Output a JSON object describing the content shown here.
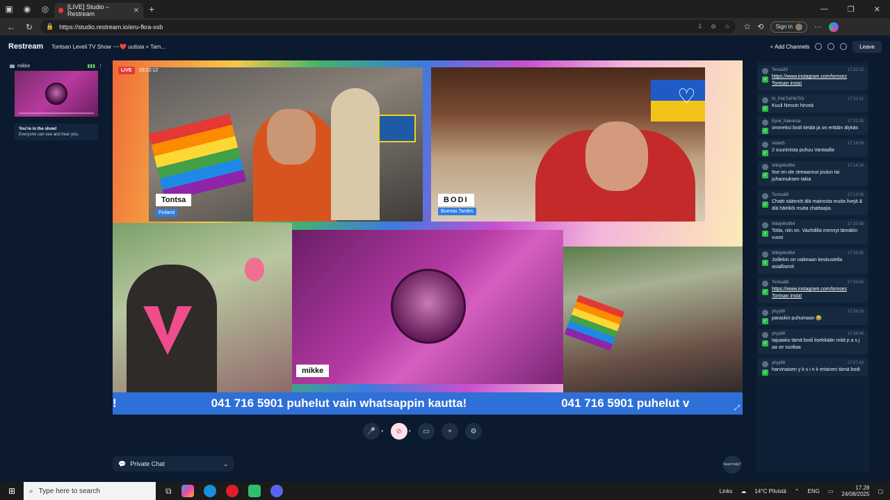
{
  "browser": {
    "tab_title": "[LIVE] Studio – Restream",
    "url": "https://studio.restream.io/eru-fkra-xsb",
    "sign_in_label": "Sign in"
  },
  "header": {
    "brand": "Restream",
    "show_title": "Tontsan Leveli TV Show 〰️❤️ uutisia + Tam...",
    "add_channels": "+ Add Channels",
    "leave": "Leave"
  },
  "left_panel": {
    "preview_name": "mikke",
    "in_show_title": "You're in the show!",
    "in_show_sub": "Everyone can see and hear you."
  },
  "stage": {
    "live_label": "LIVE",
    "live_time": "03:22:12",
    "guest1_name": "Tontsa",
    "guest1_sub": "Finland",
    "guest2_name": "BODI",
    "guest2_sub": "Buenas Tardes",
    "guest3_name": "mikke",
    "ticker_text_a": "!",
    "ticker_text_b": "041 716 5901 puhelut vain whatsappin kautta!",
    "ticker_text_c": "041 716 5901 puhelut v"
  },
  "bottom": {
    "private_chat": "Private Chat",
    "need_help": "Need help?"
  },
  "chat": [
    {
      "user": "Tonsa33",
      "time": "17:22:13",
      "text": "https://www.instagram.com/tomsez Tontsan insta!",
      "link": true
    },
    {
      "user": "M_FAKTAFIKTIO",
      "time": "17:22:11",
      "text": "Kuuli Nessin hirveä",
      "link": false
    },
    {
      "user": "Epok_Nakoksai",
      "time": "17:21:29",
      "text": "ommeksi bodi tietää ja on erittäin älykäs",
      "link": false
    },
    {
      "user": "Aldeb5",
      "time": "17:14:09",
      "text": "2 suurimista puhuu Vantaalla",
      "link": false
    },
    {
      "user": "WildyWolf84",
      "time": "17:14:19",
      "text": "Itse en ole streaannut joulun tai juhannuksen takia",
      "link": false
    },
    {
      "user": "Tontsa88",
      "time": "17:13:08",
      "text": "Chatti säännöt älä mainosta muita livejä & älä häiriköi muita chattaajia.",
      "link": false
    },
    {
      "user": "WildyWolf84",
      "time": "17:10:59",
      "text": "Totta, niin on. Vauhdilla mennyt tämäkin vuosi",
      "link": false
    },
    {
      "user": "WildyWolf84",
      "time": "17:09:35",
      "text": "Joillekin on vaikeaan keskustella asiallisesti",
      "link": false
    },
    {
      "user": "Tontsa88",
      "time": "17:09:44",
      "text": "https://www.instagram.com/tomsez Tontsan insta!",
      "link": true
    },
    {
      "user": "yhyy69",
      "time": "17:08:19",
      "text": "paraskin puhumaan 😂",
      "link": false
    },
    {
      "user": "yhyy69",
      "time": "17:08:04",
      "text": "tajuaako tämä bodi itsekkään mitä p a s j aa se suoltaa",
      "link": false
    },
    {
      "user": "yhyy69",
      "time": "17:07:43",
      "text": "harvinaisen y k s i n k ertainen tämä bodi",
      "link": false
    }
  ],
  "taskbar": {
    "search_placeholder": "Type here to search",
    "links": "Links",
    "weather": "14°C  Pilvistä",
    "lang": "ENG",
    "time": "17.28",
    "date": "24/08/2025"
  }
}
